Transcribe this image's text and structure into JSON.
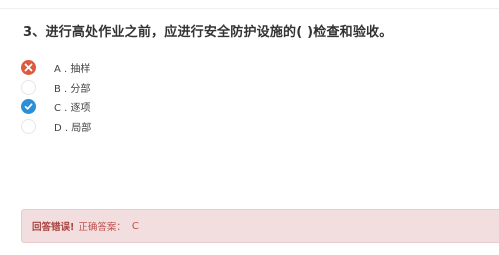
{
  "question": {
    "text": "3、进行高处作业之前，应进行安全防护设施的( )检查和验收。"
  },
  "options": [
    {
      "letter_label": "A . 抽样",
      "state": "wrong-selected",
      "icon": "cross-icon",
      "color": "#e0583d"
    },
    {
      "letter_label": "B . 分部",
      "state": "unselected",
      "icon": "",
      "color": "#ffffff"
    },
    {
      "letter_label": "C . 逐项",
      "state": "correct",
      "icon": "check-icon",
      "color": "#2a8fd6"
    },
    {
      "letter_label": "D . 局部",
      "state": "unselected",
      "icon": "",
      "color": "#ffffff"
    }
  ],
  "result": {
    "wrong_label": "回答错误!",
    "answer_label": "正确答案：",
    "answer_value": "C",
    "background": "#f2dede",
    "text_color": "#a94442"
  }
}
